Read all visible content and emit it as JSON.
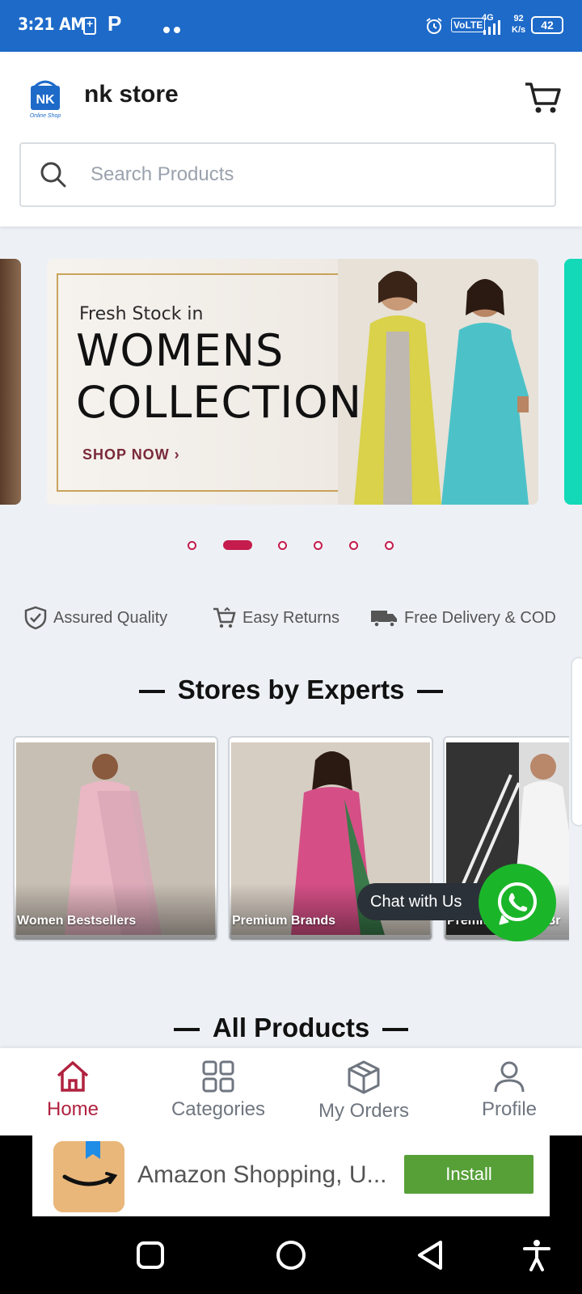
{
  "status_bar": {
    "time": "3:21 AM",
    "carrier_letter": "P",
    "volte": "VoLTE",
    "network": "4G",
    "speed_value": "92",
    "speed_unit": "K/s",
    "battery": "42"
  },
  "header": {
    "store_name": "nk store",
    "logo_text": "NK",
    "logo_subtext": "Online Shop"
  },
  "search": {
    "placeholder": "Search Products"
  },
  "banner": {
    "line1": "Fresh Stock in",
    "line2": "WOMENS",
    "line3": "COLLECTION",
    "cta": "SHOP NOW ›",
    "active_slide": 2,
    "slide_count": 6
  },
  "features": [
    {
      "label": "Assured Quality",
      "icon": "shield-check-icon"
    },
    {
      "label": "Easy Returns",
      "icon": "cart-return-icon"
    },
    {
      "label": "Free Delivery & COD",
      "icon": "delivery-truck-icon"
    }
  ],
  "stores_section": {
    "title": "Stores by Experts",
    "cards": [
      {
        "label": "Women Bestsellers"
      },
      {
        "label": "Premium Brands"
      },
      {
        "label": "Premium Bridal Br"
      }
    ]
  },
  "chat": {
    "label": "Chat with Us"
  },
  "all_products": {
    "title": "All Products"
  },
  "bottom_nav": [
    {
      "label": "Home",
      "icon": "home-icon",
      "active": true
    },
    {
      "label": "Categories",
      "icon": "grid-icon",
      "active": false
    },
    {
      "label": "My Orders",
      "icon": "box-icon",
      "active": false
    },
    {
      "label": "Profile",
      "icon": "user-icon",
      "active": false
    }
  ],
  "ad": {
    "title": "Amazon Shopping, U...",
    "install_label": "Install"
  },
  "colors": {
    "status_bar": "#1d6ac9",
    "accent": "#c41c4c",
    "whatsapp": "#1bb52a",
    "install": "#57a038"
  }
}
